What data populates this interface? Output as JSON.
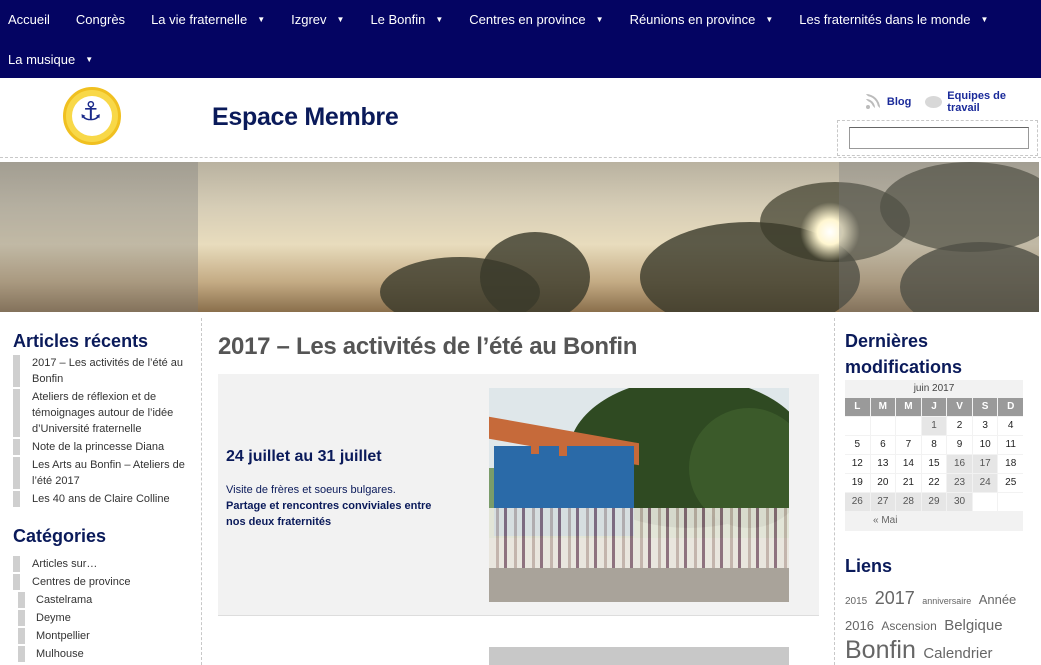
{
  "nav": {
    "row1": [
      {
        "label": "Accueil",
        "caret": false
      },
      {
        "label": "Congrès",
        "caret": false
      },
      {
        "label": "La vie fraternelle",
        "caret": true
      },
      {
        "label": "Izgrev",
        "caret": true
      },
      {
        "label": "Le Bonfin",
        "caret": true
      },
      {
        "label": "Centres en province",
        "caret": true
      },
      {
        "label": "Réunions en province",
        "caret": true
      },
      {
        "label": "Les fraternités dans le monde",
        "caret": true
      }
    ],
    "row2": [
      {
        "label": "La musique",
        "caret": true
      }
    ],
    "caret_glyph": "▼"
  },
  "header": {
    "title": "Espace Membre",
    "blog_label": "Blog",
    "teams_label": "Equipes de travail"
  },
  "left": {
    "recent_title": "Articles récents",
    "recent": [
      "2017 – Les activités de l’été au Bonfin",
      "Ateliers de réflexion et de témoignages autour de l’idée d’Université fraternelle",
      "Note de la princesse Diana",
      "Les Arts au Bonfin – Ateliers de l’été 2017",
      "Les 40 ans de Claire Colline"
    ],
    "cats_title": "Catégories",
    "cats": [
      {
        "label": "Articles sur…",
        "sub": false
      },
      {
        "label": "Centres de province",
        "sub": false
      },
      {
        "label": "Castelrama",
        "sub": true
      },
      {
        "label": "Deyme",
        "sub": true
      },
      {
        "label": "Montpellier",
        "sub": true
      },
      {
        "label": "Mulhouse",
        "sub": true
      }
    ]
  },
  "main": {
    "title": "2017 – Les activités de l’été au Bonfin",
    "date": "24 juillet au 31 juillet",
    "text1": "Visite de frères et soeurs bulgares.",
    "text2": "Partage et rencontres conviviales entre nos deux fraternités"
  },
  "right": {
    "mods_title": "Dernières modifications",
    "calendar": {
      "caption": "juin 2017",
      "heads": [
        "L",
        "M",
        "M",
        "J",
        "V",
        "S",
        "D"
      ],
      "weeks": [
        [
          "",
          "",
          "",
          "1",
          "2",
          "3",
          "4"
        ],
        [
          "5",
          "6",
          "7",
          "8",
          "9",
          "10",
          "11"
        ],
        [
          "12",
          "13",
          "14",
          "15",
          "16",
          "17",
          "18"
        ],
        [
          "19",
          "20",
          "21",
          "22",
          "23",
          "24",
          "25"
        ],
        [
          "26",
          "27",
          "28",
          "29",
          "30",
          "",
          ""
        ]
      ],
      "prev": "« Mai"
    },
    "links_title": "Liens",
    "tags": [
      {
        "label": "2015",
        "size": 10
      },
      {
        "label": "2017",
        "size": 18
      },
      {
        "label": "anniversaire",
        "size": 9
      },
      {
        "label": "Année",
        "size": 13
      },
      {
        "label": "2016",
        "size": 13
      },
      {
        "label": "Ascension",
        "size": 12
      },
      {
        "label": "Belgique",
        "size": 15
      },
      {
        "label": "Bonfin",
        "size": 25
      },
      {
        "label": "Calendrier",
        "size": 15
      }
    ]
  }
}
